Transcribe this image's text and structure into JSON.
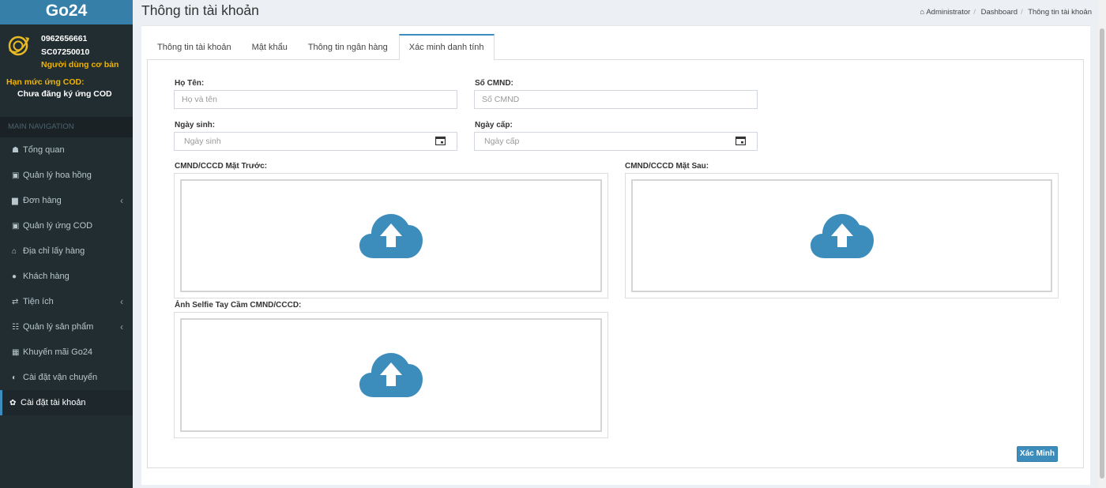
{
  "app": {
    "logo": "Go24"
  },
  "user": {
    "phone": "0962656661",
    "code": "SC07250010",
    "role": "Người dùng cơ bản"
  },
  "cod": {
    "label": "Hạn mức ứng COD:",
    "value": "Chưa đăng ký ứng COD"
  },
  "nav": {
    "header": "MAIN NAVIGATION",
    "items": [
      {
        "label": "Tổng quan",
        "icon": "dashboard-icon",
        "glyph": "☗",
        "has_children": false
      },
      {
        "label": "Quản lý hoa hồng",
        "icon": "money-icon",
        "glyph": "▣",
        "has_children": false
      },
      {
        "label": "Đơn hàng",
        "icon": "shopping-bag-icon",
        "glyph": "▆",
        "has_children": true
      },
      {
        "label": "Quản lý ứng COD",
        "icon": "money-icon",
        "glyph": "▣",
        "has_children": false
      },
      {
        "label": "Địa chỉ lấy hàng",
        "icon": "bank-icon",
        "glyph": "⌂",
        "has_children": false
      },
      {
        "label": "Khách hàng",
        "icon": "user-icon",
        "glyph": "●",
        "has_children": false
      },
      {
        "label": "Tiện ích",
        "icon": "exchange-icon",
        "glyph": "⇄",
        "has_children": true
      },
      {
        "label": "Quản lý sản phẩm",
        "icon": "th-list-icon",
        "glyph": "☷",
        "has_children": true
      },
      {
        "label": "Khuyến mãi Go24",
        "icon": "gift-icon",
        "glyph": "▦",
        "has_children": false
      },
      {
        "label": "Cài đặt vận chuyển",
        "icon": "toggle-icon",
        "glyph": "◐",
        "has_children": false
      },
      {
        "label": "Cài đặt tài khoản",
        "icon": "gear-icon",
        "glyph": "✿",
        "has_children": false,
        "active": true
      }
    ]
  },
  "page": {
    "title": "Thông tin tài khoản"
  },
  "breadcrumb": {
    "items": [
      "Administrator",
      "Dashboard",
      "Thông tin tài khoản"
    ]
  },
  "tabs": [
    {
      "label": "Thông tin tài khoản"
    },
    {
      "label": "Mật khẩu"
    },
    {
      "label": "Thông tin ngân hàng"
    },
    {
      "label": "Xác minh danh tính",
      "active": true
    }
  ],
  "form": {
    "name_label": "Họ Tên:",
    "name_placeholder": "Họ và tên",
    "id_label": "Số CMND:",
    "id_placeholder": "Số CMND",
    "dob_label": "Ngày sinh:",
    "dob_placeholder": "Ngày sinh",
    "issue_label": "Ngày cấp:",
    "issue_placeholder": "Ngày cấp",
    "front_label": "CMND/CCCD Mặt Trước:",
    "back_label": "CMND/CCCD Mặt Sau:",
    "selfie_label": "Ảnh Selfie Tay Cầm CMND/CCCD:",
    "submit_label": "Xác Minh"
  },
  "colors": {
    "primary": "#3c8dbc",
    "sidebar": "#222d32",
    "upload_icon": "#3c8dbc",
    "role": "#f0b400"
  }
}
